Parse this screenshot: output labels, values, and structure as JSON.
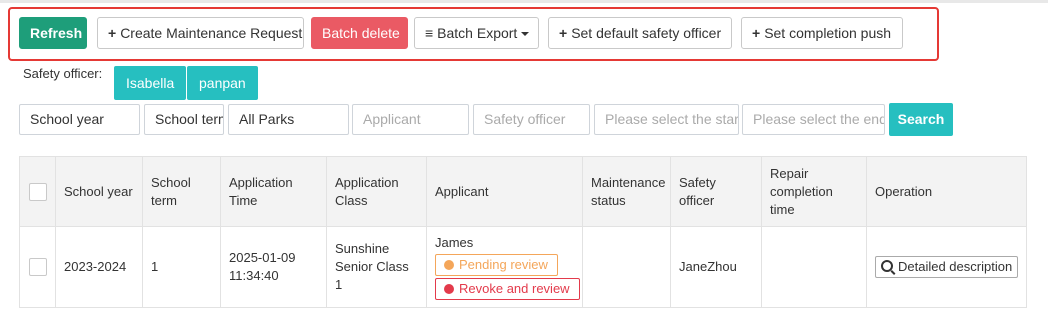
{
  "toolbar": {
    "refresh": "Refresh",
    "create": "Create Maintenance Request",
    "batch_delete": "Batch delete",
    "batch_export": "Batch Export",
    "set_default_officer": "Set default safety officer",
    "set_completion_push": "Set completion push"
  },
  "safety_officer": {
    "label": "Safety officer:",
    "tags": [
      "Isabella",
      "panpan"
    ]
  },
  "filters": {
    "school_year": "School year",
    "school_term": "School term",
    "parks": "All Parks",
    "applicant_placeholder": "Applicant",
    "safety_officer_placeholder": "Safety officer",
    "start_placeholder": "Please select the start",
    "end_placeholder": "Please select the end date",
    "search": "Search"
  },
  "table": {
    "headers": [
      "School year",
      "School term",
      "Application Time",
      "Application Class",
      "Applicant",
      "Maintenance status",
      "Safety officer",
      "Repair completion time",
      "Operation"
    ],
    "rows": [
      {
        "school_year": "2023-2024",
        "school_term": "1",
        "application_time": "2025-01-09 11:34:40",
        "application_class": "Sunshine Senior Class 1",
        "applicant": "James",
        "badge_pending": "Pending review",
        "badge_revoke": "Revoke and review",
        "maintenance_status": "",
        "safety_officer": "JaneZhou",
        "repair_completion_time": "",
        "operation": "Detailed description"
      }
    ]
  },
  "colors": {
    "primary_green": "#1e9e7a",
    "danger_red": "#ea5a64",
    "teal": "#26bfc0",
    "pending_orange": "#f4a65a",
    "revoke_red": "#e33a4b",
    "highlight_border": "#e53935"
  },
  "icons": {
    "create": "plus-icon",
    "batch_export": "list-icon",
    "set_default_officer": "plus-icon",
    "set_completion_push": "plus-icon",
    "operation": "search-icon"
  }
}
